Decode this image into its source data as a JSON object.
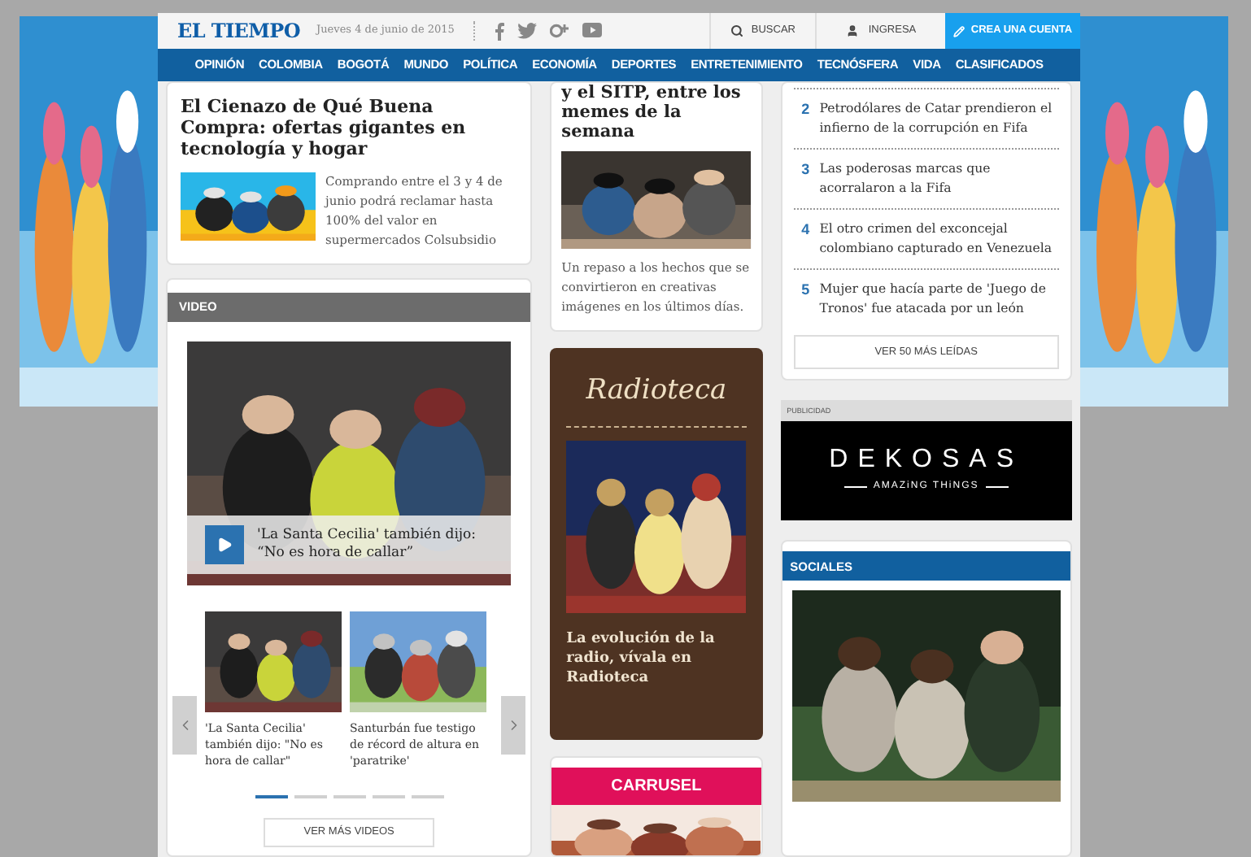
{
  "header": {
    "logo": "EL TIEMPO",
    "date": "Jueves 4 de junio de 2015",
    "search": "BUSCAR",
    "login": "INGRESA",
    "signup": "CREA UNA CUENTA"
  },
  "nav": [
    "OPINIÓN",
    "COLOMBIA",
    "BOGOTÁ",
    "MUNDO",
    "POLÍTICA",
    "ECONOMÍA",
    "DEPORTES",
    "ENTRETENIMIENTO",
    "TECNÓSFERA",
    "VIDA",
    "CLASIFICADOS"
  ],
  "promo": {
    "title": "El Cienazo de Qué Buena Compra: ofertas gigantes en tecnología y hogar",
    "text": "Comprando entre el 3 y 4 de junio podrá reclamar hasta 100% del valor en supermercados Colsubsidio"
  },
  "video": {
    "heading": "VIDEO",
    "main_title": "'La Santa Cecilia' también dijo: “No es hora de callar”",
    "thumbs": [
      {
        "title": "'La Santa Cecilia' también dijo: \"No es hora de callar\""
      },
      {
        "title": "Santurbán fue testigo de récord de altura en 'paratrike'"
      }
    ],
    "dots": [
      {
        "selected": true
      },
      {
        "selected": false
      },
      {
        "selected": false
      },
      {
        "selected": false
      },
      {
        "selected": false
      }
    ],
    "more": "VER MÁS VIDEOS"
  },
  "memes": {
    "title": "y el SITP, entre los memes de la semana",
    "text": "Un repaso a los hechos que se convirtieron en creativas imágenes en los últimos días."
  },
  "radioteca": {
    "logo": "Radioteca",
    "caption": "La evolución de la radio, vívala en Radioteca"
  },
  "carrusel": {
    "label": "CARRUSEL"
  },
  "most_read": {
    "items": [
      {
        "rank": "2",
        "title": "Petrodólares de Catar prendieron el infierno de la corrupción en Fifa"
      },
      {
        "rank": "3",
        "title": "Las poderosas marcas que acorralaron a la Fifa"
      },
      {
        "rank": "4",
        "title": "El otro crimen del exconcejal colombiano capturado en Venezuela"
      },
      {
        "rank": "5",
        "title": "Mujer que hacía parte de 'Juego de Tronos' fue atacada por un león"
      }
    ],
    "more": "VER 50 MÁS LEÍDAS"
  },
  "ad": {
    "label": "PUBLICIDAD",
    "brand": "DEKOSAS",
    "tagline": "AMAZiNG THiNGS"
  },
  "sociales": {
    "heading": "SOCIALES"
  }
}
